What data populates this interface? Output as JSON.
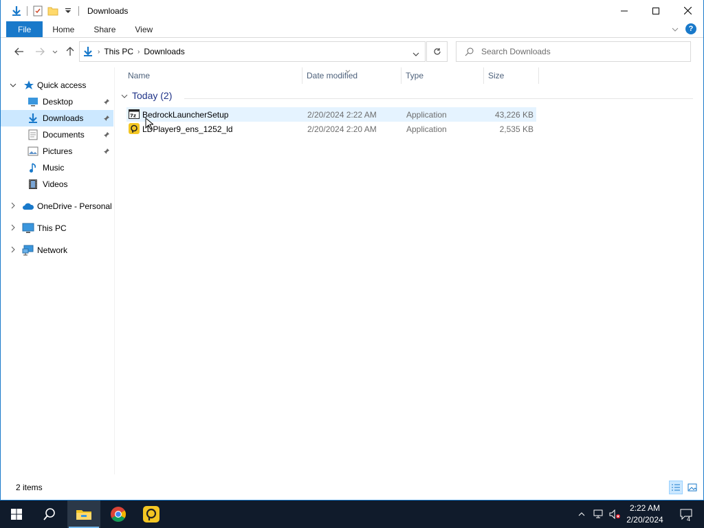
{
  "window": {
    "title": "Downloads"
  },
  "ribbon": {
    "tabs": [
      {
        "label": "File"
      },
      {
        "label": "Home"
      },
      {
        "label": "Share"
      },
      {
        "label": "View"
      }
    ]
  },
  "address": {
    "crumbs": [
      "This PC",
      "Downloads"
    ],
    "search_placeholder": "Search Downloads"
  },
  "navpane": {
    "items": [
      {
        "label": "Quick access",
        "icon": "star-icon"
      },
      {
        "label": "Desktop",
        "icon": "desktop-icon",
        "pinned": true
      },
      {
        "label": "Downloads",
        "icon": "downloads-icon",
        "pinned": true,
        "selected": true
      },
      {
        "label": "Documents",
        "icon": "documents-icon",
        "pinned": true
      },
      {
        "label": "Pictures",
        "icon": "pictures-icon",
        "pinned": true
      },
      {
        "label": "Music",
        "icon": "music-icon"
      },
      {
        "label": "Videos",
        "icon": "videos-icon"
      },
      {
        "label": "OneDrive - Personal",
        "icon": "onedrive-icon"
      },
      {
        "label": "This PC",
        "icon": "this-pc-icon"
      },
      {
        "label": "Network",
        "icon": "network-icon"
      }
    ]
  },
  "columns": {
    "name": "Name",
    "date": "Date modified",
    "type": "Type",
    "size": "Size"
  },
  "group": {
    "label": "Today (2)"
  },
  "files": [
    {
      "name": "BedrockLauncherSetup",
      "date": "2/20/2024 2:22 AM",
      "type": "Application",
      "size": "43,226 KB",
      "icon": "7zip-installer-icon"
    },
    {
      "name": "LDPlayer9_ens_1252_ld",
      "date": "2/20/2024 2:20 AM",
      "type": "Application",
      "size": "2,535 KB",
      "icon": "ldplayer-icon"
    }
  ],
  "status": {
    "items_count": "2 items"
  },
  "taskbar": {
    "time": "2:22 AM",
    "date": "2/20/2024",
    "notification_count": "4"
  },
  "colors": {
    "accent": "#1979ca",
    "selection": "#cce8ff",
    "hover": "#e5f3ff",
    "taskbar": "#101b2b"
  }
}
